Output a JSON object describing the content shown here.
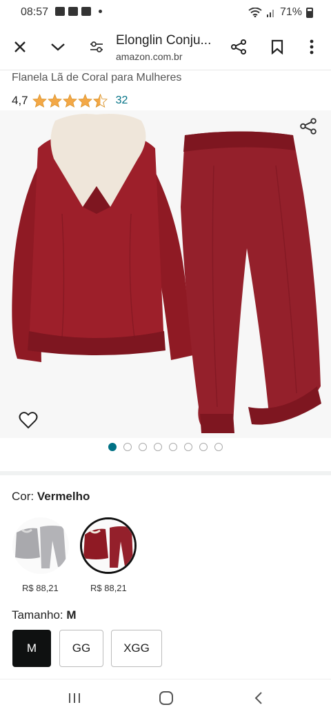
{
  "status_bar": {
    "time": "08:57",
    "battery": "71%"
  },
  "toolbar": {
    "title": "Elonglin Conju...",
    "url": "amazon.com.br"
  },
  "product": {
    "subtitle": "Flanela Lã de Coral para Mulheres",
    "rating": "4,7",
    "stars": 4.5,
    "review_count": "32",
    "image_count": 8,
    "active_image": 1
  },
  "color": {
    "label": "Cor: ",
    "value": "Vermelho",
    "options": [
      {
        "name": "gray",
        "price": "R$ 88,21"
      },
      {
        "name": "red",
        "price": "R$ 88,21"
      }
    ]
  },
  "size": {
    "label": "Tamanho: ",
    "value": "M",
    "options": [
      "M",
      "GG",
      "XGG"
    ]
  },
  "colors": {
    "accent": "#007185",
    "star": "#f3a847",
    "garment": "#8f1a24"
  }
}
